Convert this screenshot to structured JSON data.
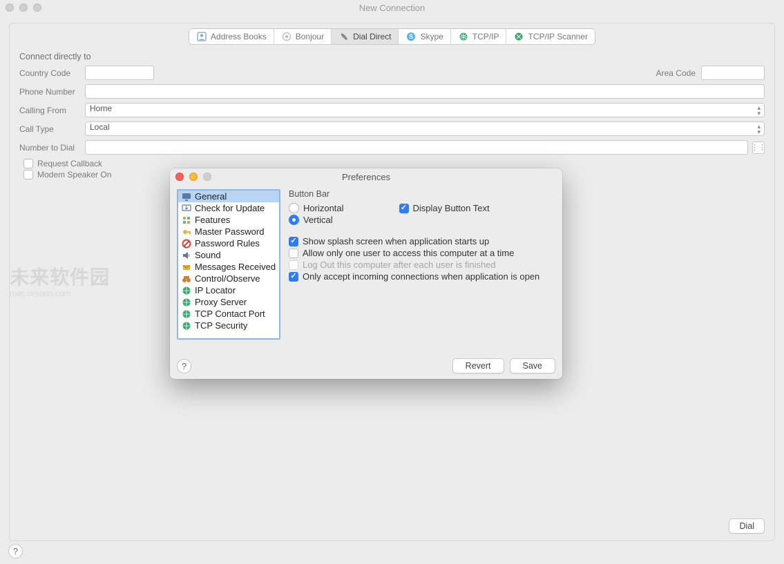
{
  "window": {
    "title": "New Connection"
  },
  "tabs": [
    {
      "label": "Address Books",
      "icon": "address-book-icon"
    },
    {
      "label": "Bonjour",
      "icon": "bonjour-icon"
    },
    {
      "label": "Dial Direct",
      "icon": "phone-icon",
      "selected": true
    },
    {
      "label": "Skype",
      "icon": "skype-icon"
    },
    {
      "label": "TCP/IP",
      "icon": "globe-icon"
    },
    {
      "label": "TCP/IP Scanner",
      "icon": "scanner-icon"
    }
  ],
  "form": {
    "section_label": "Connect directly to",
    "country_code_label": "Country Code",
    "area_code_label": "Area Code",
    "phone_number_label": "Phone Number",
    "calling_from_label": "Calling From",
    "calling_from_value": "Home",
    "call_type_label": "Call Type",
    "call_type_value": "Local",
    "number_to_dial_label": "Number to Dial",
    "request_callback_label": "Request Callback",
    "modem_speaker_label": "Modem Speaker On",
    "dial_button": "Dial"
  },
  "prefs": {
    "title": "Preferences",
    "sidebar": [
      {
        "label": "General",
        "selected": true
      },
      {
        "label": "Check for Update"
      },
      {
        "label": "Features"
      },
      {
        "label": "Master Password"
      },
      {
        "label": "Password Rules"
      },
      {
        "label": "Sound"
      },
      {
        "label": "Messages Received"
      },
      {
        "label": "Control/Observe"
      },
      {
        "label": "IP Locator"
      },
      {
        "label": "Proxy Server"
      },
      {
        "label": "TCP Contact Port"
      },
      {
        "label": "TCP Security"
      }
    ],
    "button_bar": {
      "title": "Button Bar",
      "horizontal": "Horizontal",
      "vertical": "Vertical",
      "display_text": "Display Button Text",
      "orientation": "vertical",
      "display_text_checked": true
    },
    "opts": {
      "splash": {
        "label": "Show splash screen when application starts up",
        "checked": true
      },
      "single_user": {
        "label": "Allow only one user to access this computer at a time",
        "checked": false
      },
      "logout": {
        "label": "Log Out this computer after each user is finished",
        "checked": false,
        "disabled": true
      },
      "incoming": {
        "label": "Only accept incoming connections when application is open",
        "checked": true
      }
    },
    "revert": "Revert",
    "save": "Save"
  },
  "watermark": {
    "line1": "未来软件园",
    "line2": "mac.orsoon.com"
  }
}
